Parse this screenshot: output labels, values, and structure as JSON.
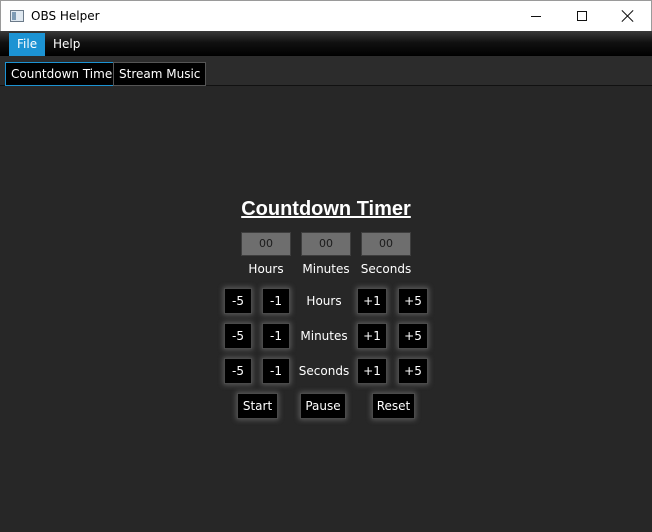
{
  "window": {
    "title": "OBS Helper"
  },
  "menu": {
    "file": "File",
    "help": "Help"
  },
  "tabs": [
    {
      "label": "Countdown Timer",
      "active": true
    },
    {
      "label": "Stream Music",
      "active": false
    }
  ],
  "timer": {
    "title": "Countdown Timer",
    "fields": [
      {
        "value": "00",
        "label": "Hours"
      },
      {
        "value": "00",
        "label": "Minutes"
      },
      {
        "value": "00",
        "label": "Seconds"
      }
    ],
    "rows": [
      {
        "label": "Hours",
        "buttons": [
          "-5",
          "-1",
          "+1",
          "+5"
        ]
      },
      {
        "label": "Minutes",
        "buttons": [
          "-5",
          "-1",
          "+1",
          "+5"
        ]
      },
      {
        "label": "Seconds",
        "buttons": [
          "-5",
          "-1",
          "+1",
          "+5"
        ]
      }
    ],
    "controls": {
      "start": "Start",
      "pause": "Pause",
      "reset": "Reset"
    }
  },
  "colors": {
    "background": "#272727",
    "accent": "#1c93d3"
  }
}
